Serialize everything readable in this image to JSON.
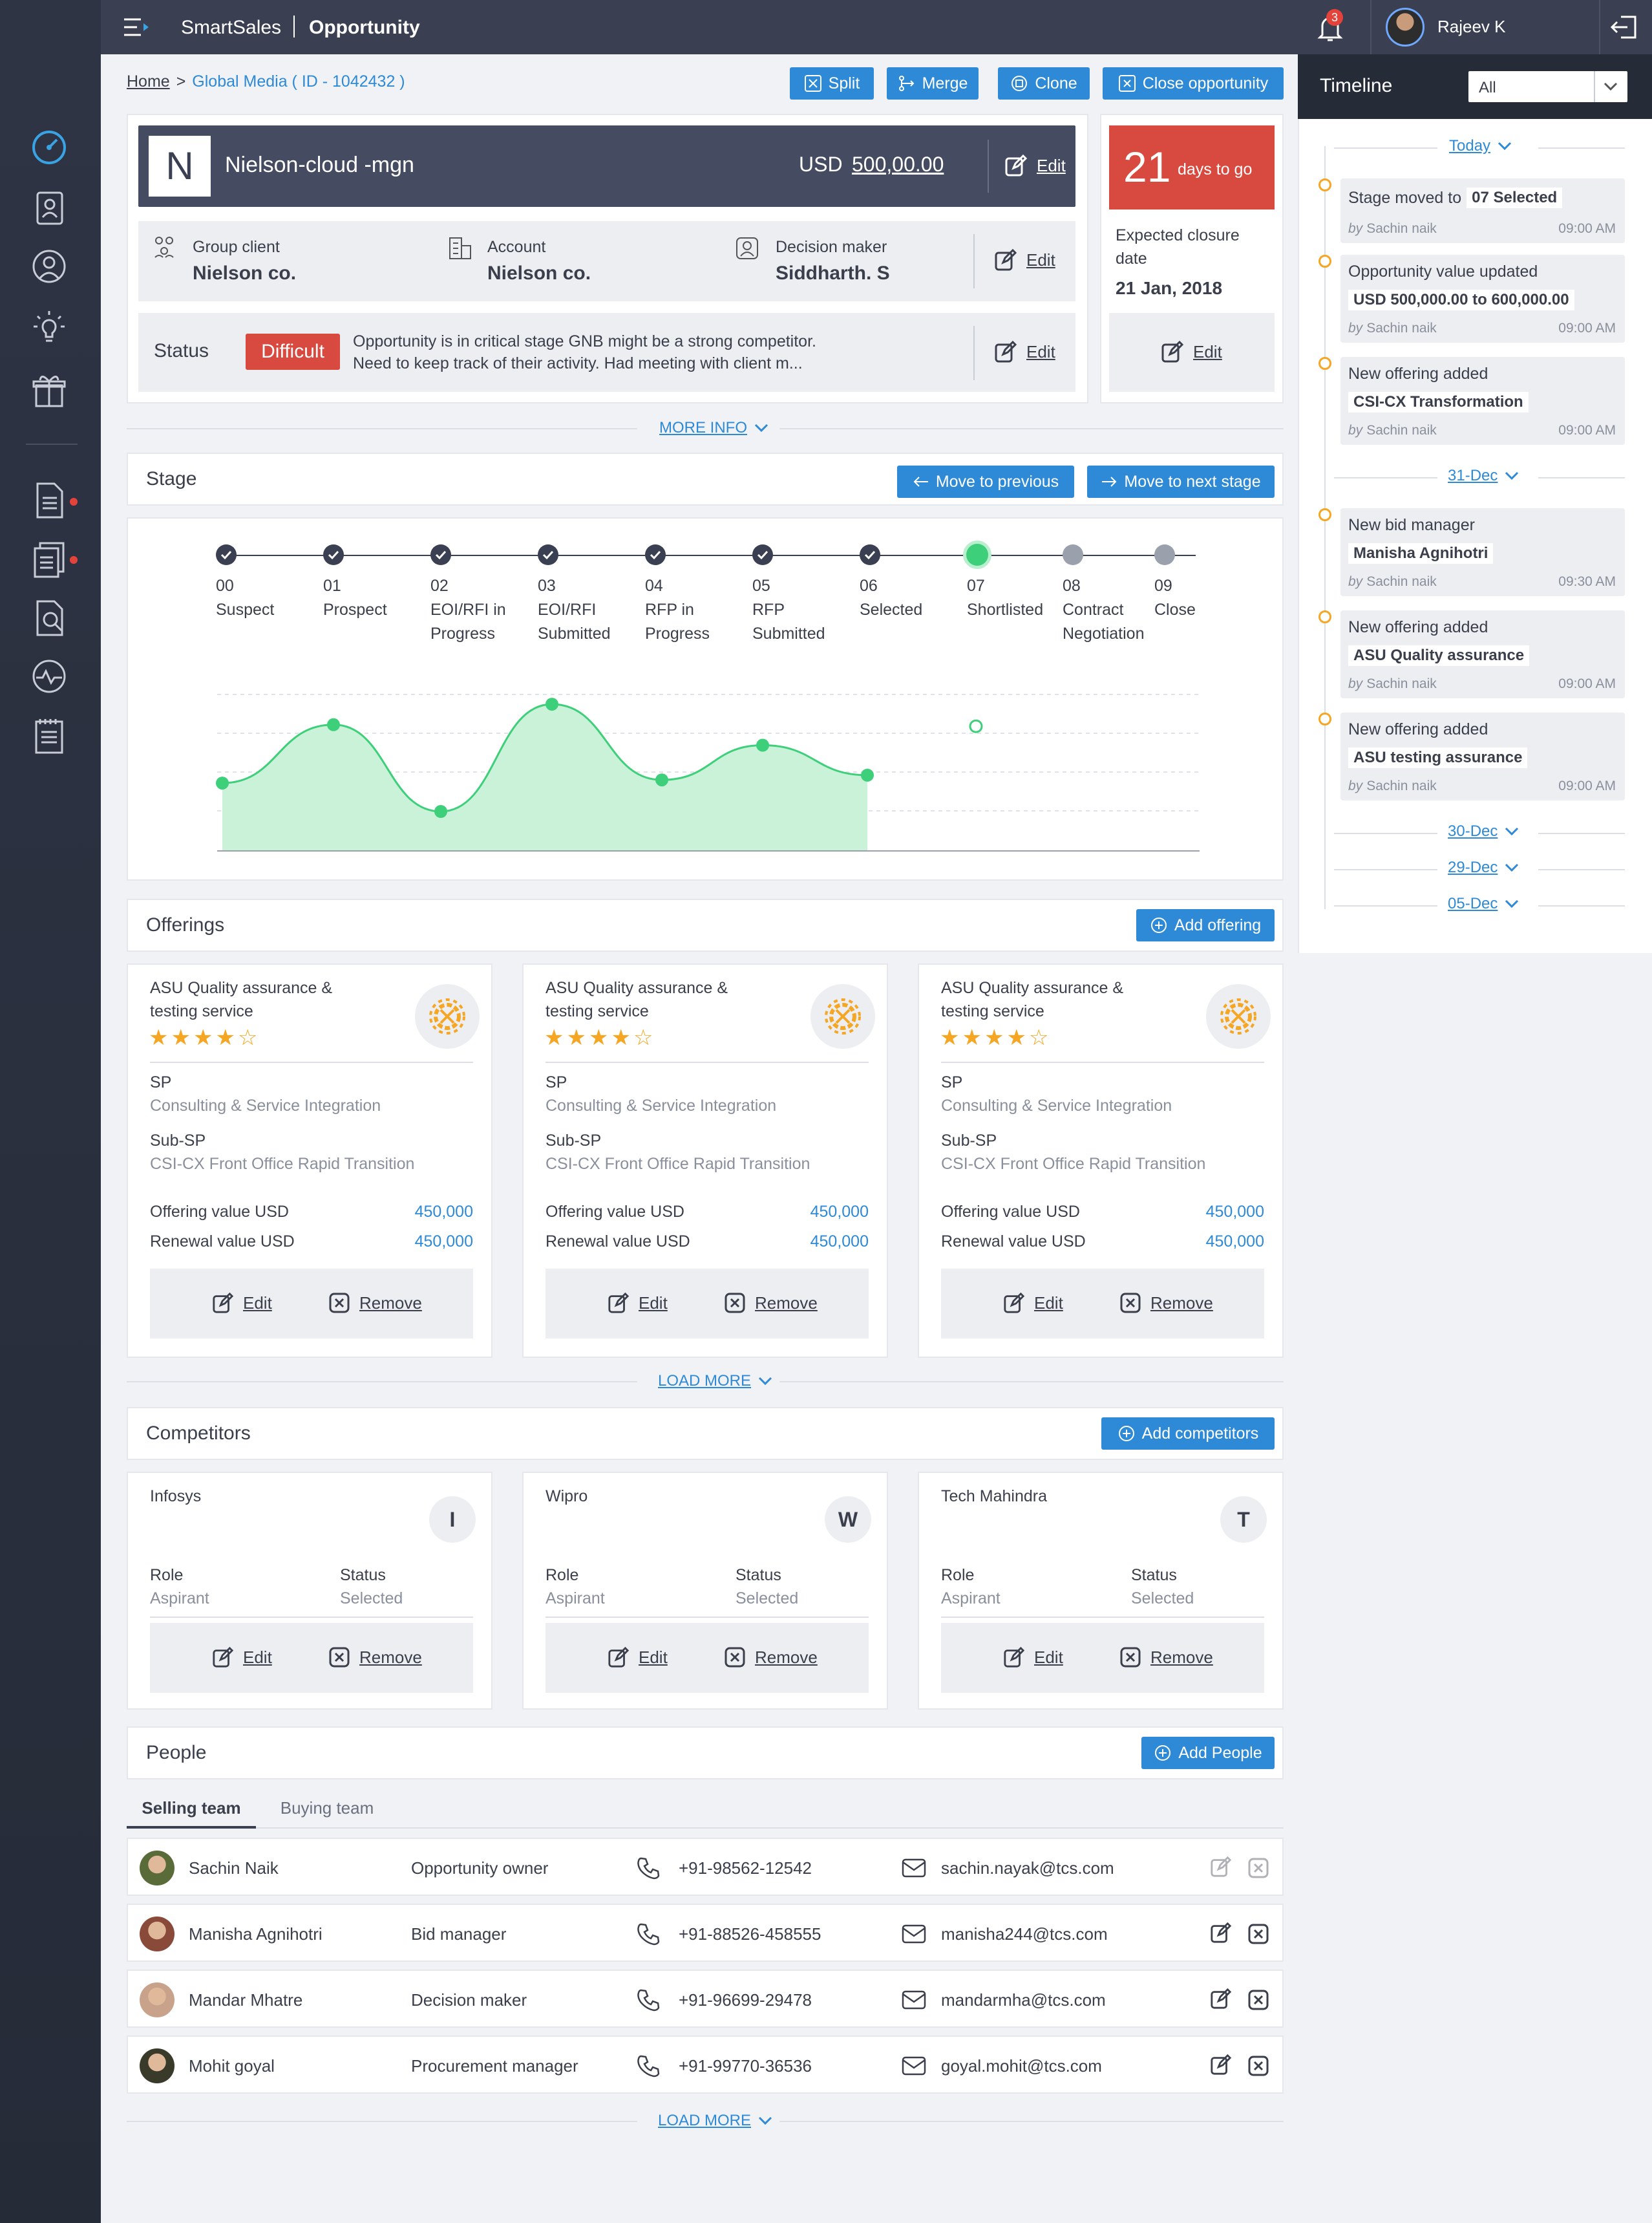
{
  "app": {
    "brand": "SmartSales",
    "page": "Opportunity",
    "notifications": "3",
    "user_name": "Rajeev K"
  },
  "breadcrumb": {
    "home": "Home",
    "sep": ">",
    "current": "Global Media ( ID - 1042432 )"
  },
  "actions": {
    "split": "Split",
    "merge": "Merge",
    "clone": "Clone",
    "close": "Close opportunity"
  },
  "opportunity": {
    "initial": "N",
    "name": "Nielson-cloud -mgn",
    "currency": "USD",
    "value": "500,00.00",
    "edit": "Edit",
    "days": "21",
    "days_label": "days to go",
    "closure_label": "Expected closure date",
    "closure_date": "21 Jan, 2018",
    "group_label": "Group client",
    "group_value": "Nielson co.",
    "account_label": "Account",
    "account_value": "Nielson co.",
    "dm_label": "Decision maker",
    "dm_value": "Siddharth. S",
    "status_label": "Status",
    "status_badge": "Difficult",
    "status_text_1": "Opportunity is in critical stage GNB might be a strong competitor.",
    "status_text_2": "Need to keep track of their activity. Had meeting with client m...",
    "more_info": "MORE INFO"
  },
  "stage": {
    "title": "Stage",
    "prev": "Move to previous",
    "next": "Move to next stage",
    "steps": [
      {
        "num": "00",
        "l1": "Suspect",
        "l2": ""
      },
      {
        "num": "01",
        "l1": "Prospect",
        "l2": ""
      },
      {
        "num": "02",
        "l1": "EOI/RFI in",
        "l2": "Progress"
      },
      {
        "num": "03",
        "l1": "EOI/RFI",
        "l2": "Submitted"
      },
      {
        "num": "04",
        "l1": "RFP in",
        "l2": "Progress"
      },
      {
        "num": "05",
        "l1": "RFP",
        "l2": "Submitted"
      },
      {
        "num": "06",
        "l1": "Selected",
        "l2": ""
      },
      {
        "num": "07",
        "l1": "Shortlisted",
        "l2": ""
      },
      {
        "num": "08",
        "l1": "Contract",
        "l2": "Negotiation"
      },
      {
        "num": "09",
        "l1": "Close",
        "l2": ""
      }
    ],
    "current_index": 7
  },
  "chart_data": {
    "type": "area",
    "x": [
      0,
      1,
      2,
      3,
      4,
      5,
      6,
      7
    ],
    "values": [
      0.43,
      0.8,
      0.25,
      0.93,
      0.45,
      0.67,
      0.48,
      0.79
    ],
    "ylim": [
      0,
      1
    ]
  },
  "offerings": {
    "title": "Offerings",
    "add": "Add offering",
    "load_more": "LOAD MORE",
    "items": [
      {
        "title1": "ASU Quality assurance &",
        "title2": "testing service",
        "rating": 4,
        "sp_label": "SP",
        "sp": "Consulting & Service Integration",
        "subsp_label": "Sub-SP",
        "subsp": "CSI-CX Front Office Rapid Transition",
        "ov_label": "Offering value  USD",
        "ov": "450,000",
        "rv_label": "Renewal value USD",
        "rv": "450,000",
        "edit": "Edit",
        "remove": "Remove"
      },
      {
        "title1": "ASU Quality assurance &",
        "title2": "testing service",
        "rating": 4,
        "sp_label": "SP",
        "sp": "Consulting & Service Integration",
        "subsp_label": "Sub-SP",
        "subsp": "CSI-CX Front Office Rapid Transition",
        "ov_label": "Offering value  USD",
        "ov": "450,000",
        "rv_label": "Renewal value USD",
        "rv": "450,000",
        "edit": "Edit",
        "remove": "Remove"
      },
      {
        "title1": "ASU Quality assurance &",
        "title2": "testing service",
        "rating": 4,
        "sp_label": "SP",
        "sp": "Consulting & Service Integration",
        "subsp_label": "Sub-SP",
        "subsp": "CSI-CX Front Office Rapid Transition",
        "ov_label": "Offering value  USD",
        "ov": "450,000",
        "rv_label": "Renewal value USD",
        "rv": "450,000",
        "edit": "Edit",
        "remove": "Remove"
      }
    ]
  },
  "competitors": {
    "title": "Competitors",
    "add": "Add competitors",
    "items": [
      {
        "name": "Infosys",
        "initial": "I",
        "role_label": "Role",
        "role": "Aspirant",
        "status_label": "Status",
        "status": "Selected",
        "edit": "Edit",
        "remove": "Remove"
      },
      {
        "name": "Wipro",
        "initial": "W",
        "role_label": "Role",
        "role": "Aspirant",
        "status_label": "Status",
        "status": "Selected",
        "edit": "Edit",
        "remove": "Remove"
      },
      {
        "name": "Tech Mahindra",
        "initial": "T",
        "role_label": "Role",
        "role": "Aspirant",
        "status_label": "Status",
        "status": "Selected",
        "edit": "Edit",
        "remove": "Remove"
      }
    ]
  },
  "people": {
    "title": "People",
    "add": "Add People",
    "tab_selling": "Selling team",
    "tab_buying": "Buying team",
    "load_more": "LOAD MORE",
    "rows": [
      {
        "name": "Sachin Naik",
        "role": "Opportunity owner",
        "phone": "+91-98562-12542",
        "email": "sachin.nayak@tcs.com"
      },
      {
        "name": "Manisha Agnihotri",
        "role": "Bid manager",
        "phone": "+91-88526-458555",
        "email": "manisha244@tcs.com"
      },
      {
        "name": "Mandar Mhatre",
        "role": "Decision maker",
        "phone": "+91-96699-29478",
        "email": "mandarmha@tcs.com"
      },
      {
        "name": "Mohit goyal",
        "role": "Procurement manager",
        "phone": "+91-99770-36536",
        "email": "goyal.mohit@tcs.com"
      }
    ]
  },
  "timeline": {
    "title": "Timeline",
    "filter": "All",
    "today": "Today",
    "d31": "31-Dec",
    "d30": "30-Dec",
    "d29": "29-Dec",
    "d05": "05-Dec",
    "items": [
      {
        "text": "Stage moved to",
        "chip": "07 Selected",
        "by": "by",
        "who": "Sachin naik",
        "time": "09:00 AM"
      },
      {
        "text": "Opportunity value updated",
        "chip": "USD 500,000.00 to 600,000.00",
        "by": "by",
        "who": "Sachin naik",
        "time": "09:00 AM"
      },
      {
        "text": "New offering added",
        "chip": "CSI-CX Transformation",
        "by": "by",
        "who": "Sachin naik",
        "time": "09:00 AM"
      },
      {
        "text": "New bid manager",
        "chip": "Manisha Agnihotri",
        "by": "by",
        "who": "Sachin naik",
        "time": "09:30 AM"
      },
      {
        "text": "New offering added",
        "chip": "ASU Quality assurance",
        "by": "by",
        "who": "Sachin naik",
        "time": "09:00 AM"
      },
      {
        "text": "New offering added",
        "chip": "ASU testing assurance",
        "by": "by",
        "who": "Sachin naik",
        "time": "09:00 AM"
      }
    ]
  }
}
